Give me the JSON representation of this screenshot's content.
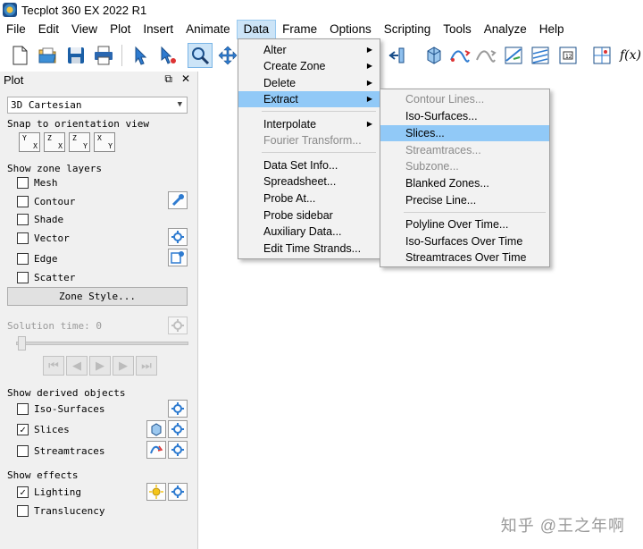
{
  "window": {
    "title": "Tecplot 360 EX 2022 R1"
  },
  "menubar": [
    "File",
    "Edit",
    "View",
    "Plot",
    "Insert",
    "Animate",
    "Data",
    "Frame",
    "Options",
    "Scripting",
    "Tools",
    "Analyze",
    "Help"
  ],
  "active_menu": "Data",
  "toolbar": {
    "icons": [
      "new-file-icon",
      "open-folder-icon",
      "save-icon",
      "print-icon",
      "select-arrow-icon",
      "adjustor-icon",
      "zoom-icon",
      "translate-icon",
      "slice-tool-icon",
      "probe-tool-icon",
      "streamtrace-tool-icon",
      "iso-surface-tool-icon",
      "contour-line-tool-icon",
      "polyline-tool-icon",
      "equation-icon"
    ],
    "equation_label": "f(x)"
  },
  "panel": {
    "title": "Plot",
    "plot_type": "3D Cartesian",
    "snap_label": "Snap to orientation view",
    "orient_buttons": [
      {
        "a1": "Y",
        "a2": "X"
      },
      {
        "a1": "Z",
        "a2": "X"
      },
      {
        "a1": "Z",
        "a2": "Y"
      },
      {
        "a1": "X",
        "a2": "Y"
      }
    ],
    "zone_layers_label": "Show zone layers",
    "zone_layers": [
      {
        "label": "Mesh",
        "checked": false
      },
      {
        "label": "Contour",
        "checked": false
      },
      {
        "label": "Shade",
        "checked": false
      },
      {
        "label": "Vector",
        "checked": false
      },
      {
        "label": "Edge",
        "checked": false
      },
      {
        "label": "Scatter",
        "checked": false
      }
    ],
    "zone_style_button": "Zone Style...",
    "solution_time_label": "Solution time:",
    "solution_time_value": "0",
    "derived_label": "Show derived objects",
    "derived": [
      {
        "label": "Iso-Surfaces",
        "checked": false
      },
      {
        "label": "Slices",
        "checked": true
      },
      {
        "label": "Streamtraces",
        "checked": false
      }
    ],
    "effects_label": "Show effects",
    "effects": [
      {
        "label": "Lighting",
        "checked": true
      },
      {
        "label": "Translucency",
        "checked": false
      }
    ]
  },
  "data_menu": [
    {
      "label": "Alter",
      "submenu": true
    },
    {
      "label": "Create Zone",
      "submenu": true
    },
    {
      "label": "Delete",
      "submenu": true
    },
    {
      "label": "Extract",
      "submenu": true,
      "highlighted": true
    },
    {
      "label": "Interpolate",
      "submenu": true
    },
    {
      "label": "Fourier Transform...",
      "disabled": true
    },
    {
      "label": "Data Set Info..."
    },
    {
      "label": "Spreadsheet..."
    },
    {
      "label": "Probe At..."
    },
    {
      "label": "Probe sidebar"
    },
    {
      "label": "Auxiliary Data..."
    },
    {
      "label": "Edit Time Strands..."
    }
  ],
  "extract_menu": [
    {
      "label": "Contour Lines...",
      "disabled": true
    },
    {
      "label": "Iso-Surfaces..."
    },
    {
      "label": "Slices...",
      "highlighted": true
    },
    {
      "label": "Streamtraces...",
      "disabled": true
    },
    {
      "label": "Subzone...",
      "disabled": true
    },
    {
      "label": "Blanked Zones..."
    },
    {
      "label": "Precise Line..."
    },
    {
      "label": "Polyline Over Time..."
    },
    {
      "label": "Iso-Surfaces Over Time"
    },
    {
      "label": "Streamtraces Over Time"
    }
  ],
  "watermark": "知乎 @王之年啊"
}
